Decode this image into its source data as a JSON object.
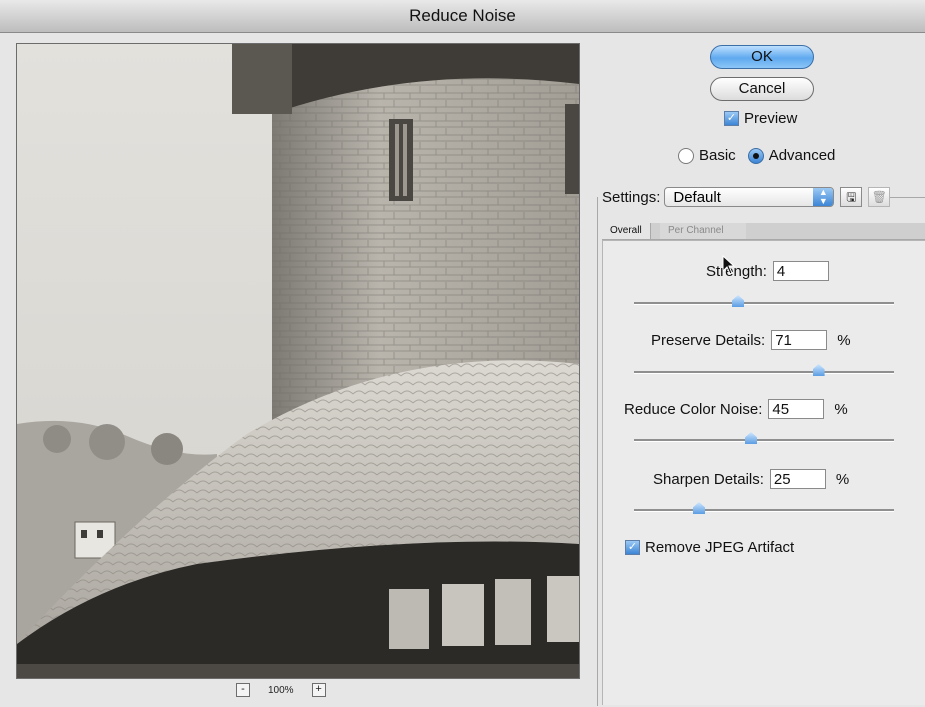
{
  "window": {
    "title": "Reduce Noise"
  },
  "preview": {
    "zoom_out": "-",
    "zoom_level": "100%",
    "zoom_in": "+"
  },
  "buttons": {
    "ok": "OK",
    "cancel": "Cancel"
  },
  "preview_checkbox": {
    "label": "Preview",
    "checked": true
  },
  "mode": {
    "basic": "Basic",
    "advanced": "Advanced",
    "selected": "Advanced"
  },
  "settings": {
    "label": "Settings:",
    "value": "Default"
  },
  "tabs": [
    {
      "label": "Overall",
      "active": true
    },
    {
      "label": "Per Channel",
      "active": false
    }
  ],
  "controls": {
    "strength": {
      "label": "Strength:",
      "value": "4",
      "unit": "",
      "slider_fraction": 0.4
    },
    "preserve_details": {
      "label": "Preserve Details:",
      "value": "71",
      "unit": "%",
      "slider_fraction": 0.71
    },
    "reduce_color_noise": {
      "label": "Reduce Color Noise:",
      "value": "45",
      "unit": "%",
      "slider_fraction": 0.45
    },
    "sharpen_details": {
      "label": "Sharpen Details:",
      "value": "25",
      "unit": "%",
      "slider_fraction": 0.25
    }
  },
  "jpeg_artifact": {
    "label": "Remove JPEG Artifact",
    "checked": true
  }
}
